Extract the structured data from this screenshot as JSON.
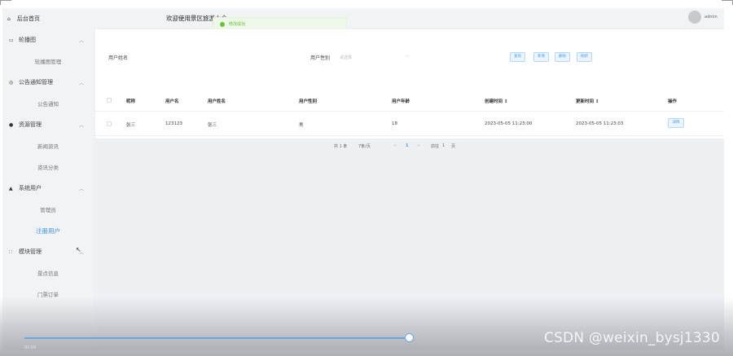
{
  "header": {
    "title": "欢迎使用景区旅游大全",
    "toast": "修改成功",
    "user": "admin"
  },
  "sidebar": {
    "home": "后台首页",
    "groups": [
      {
        "label": "轮播图",
        "items": [
          "轮播图管理"
        ]
      },
      {
        "label": "公告通知管理",
        "items": [
          "公告通知"
        ]
      },
      {
        "label": "资源管理",
        "items": [
          "新闻资讯",
          "资讯分类"
        ]
      },
      {
        "label": "系统用户",
        "items": [
          "管理员",
          "注册用户"
        ]
      },
      {
        "label": "模块管理",
        "items": [
          "景点信息",
          "门票订单"
        ]
      }
    ]
  },
  "search": {
    "name_label": "用户姓名",
    "gender_label": "用户性别",
    "gender_placeholder": "请选择",
    "buttons": [
      "查询",
      "新增",
      "删除",
      "刷新"
    ]
  },
  "table": {
    "columns": [
      "昵称",
      "用户名",
      "用户姓名",
      "用户性别",
      "用户年龄",
      "创建时间 ↕",
      "更新时间 ↕",
      "操作"
    ],
    "rows": [
      {
        "nickname": "张三",
        "username": "123123",
        "realname": "张三",
        "gender": "男",
        "age": "18",
        "created": "2023-05-05 11:23:00",
        "updated": "2023-05-05 11:23:03",
        "action": "详情"
      }
    ]
  },
  "pagination": {
    "total": "共 1 条",
    "page_size": "7条/页",
    "prev": "<",
    "current": "1",
    "next": ">",
    "goto_label": "前往",
    "goto_value": "1",
    "page_unit": "页"
  },
  "overlay": {
    "watermark": "CSDN @weixin_bysj1330",
    "bottom_label": "00:00"
  },
  "colors": {
    "accent": "#409eff",
    "active_menu": "#3a8ee6",
    "success": "#67c23a",
    "sidebar_bg": "#f2f3f5"
  }
}
